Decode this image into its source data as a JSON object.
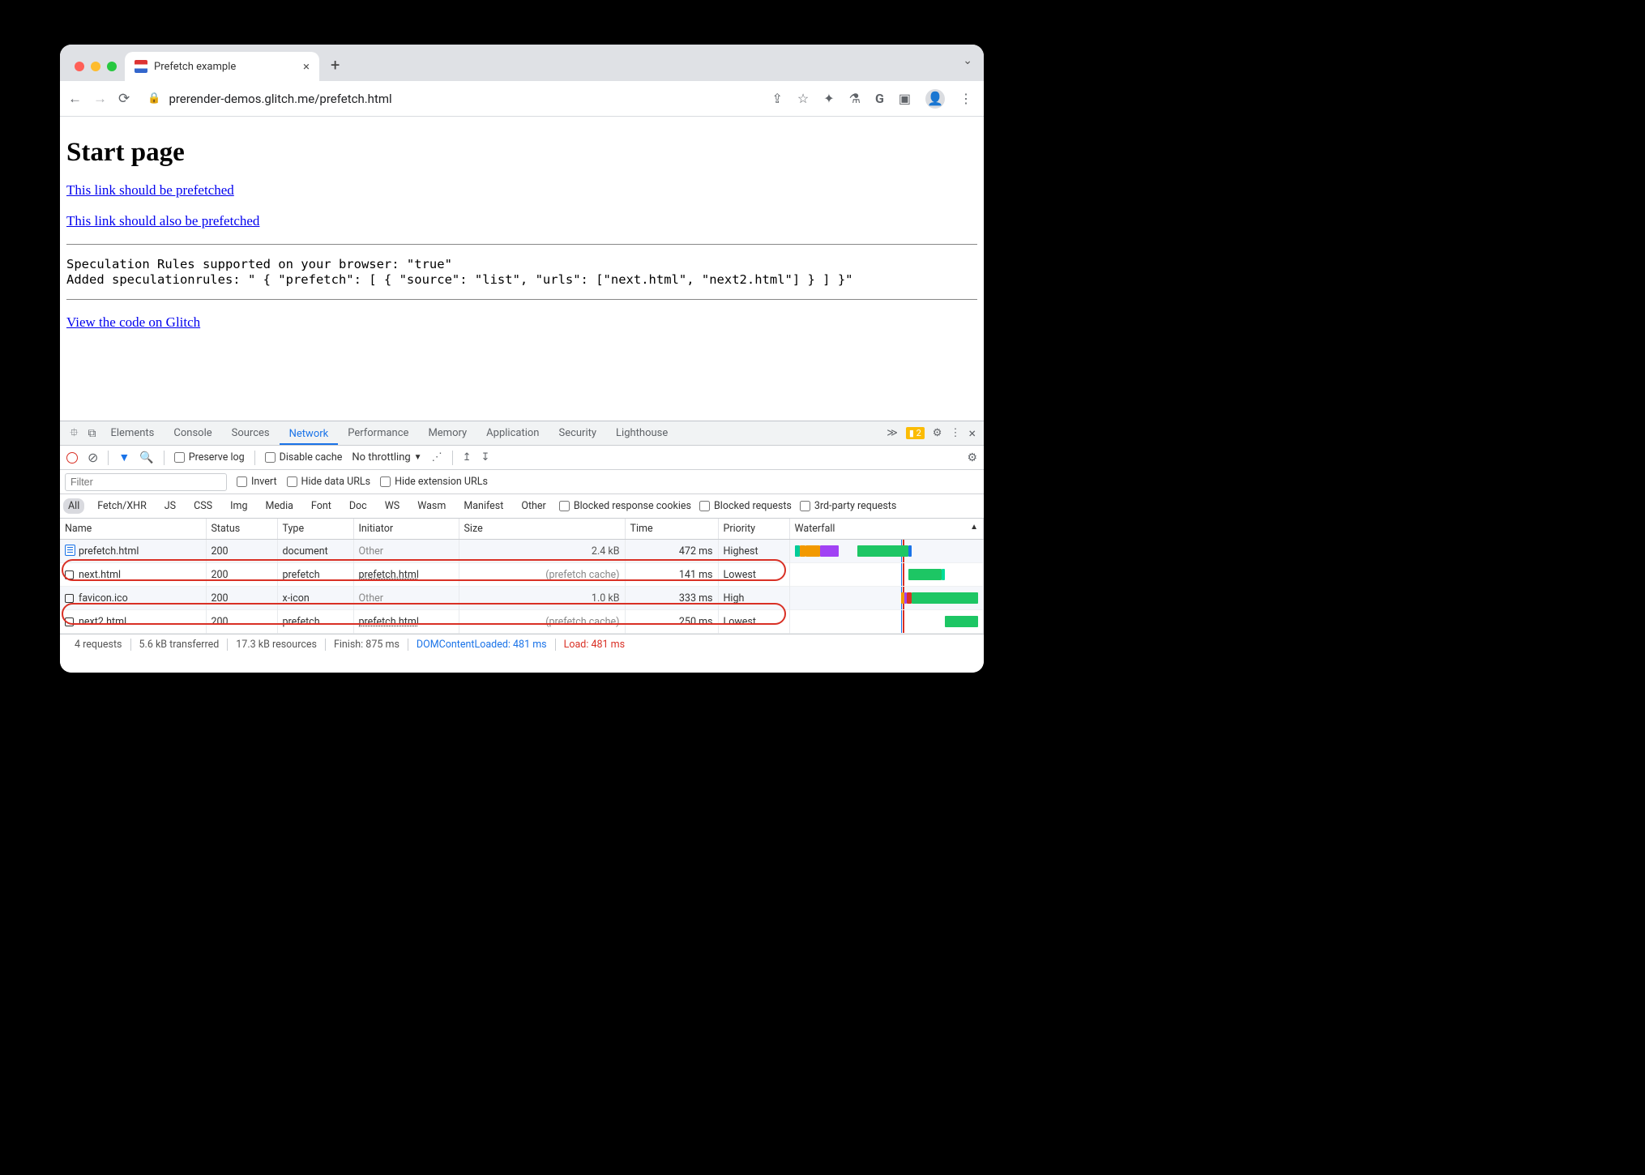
{
  "tab": {
    "title": "Prefetch example"
  },
  "url": "prerender-demos.glitch.me/prefetch.html",
  "page": {
    "heading": "Start page",
    "link1": "This link should be prefetched",
    "link2": "This link should also be prefetched",
    "code1": "Speculation Rules supported on your browser: \"true\"",
    "code2": "Added speculationrules: \" { \"prefetch\": [ { \"source\": \"list\", \"urls\": [\"next.html\", \"next2.html\"] } ] }\"",
    "link3": "View the code on Glitch"
  },
  "devtools": {
    "tabs": [
      "Elements",
      "Console",
      "Sources",
      "Network",
      "Performance",
      "Memory",
      "Application",
      "Security",
      "Lighthouse"
    ],
    "warnCount": "2",
    "controls": {
      "preserve": "Preserve log",
      "disable": "Disable cache",
      "throttle": "No throttling"
    },
    "filterPlaceholder": "Filter",
    "filterOpts": {
      "invert": "Invert",
      "hideData": "Hide data URLs",
      "hideExt": "Hide extension URLs"
    },
    "types": [
      "All",
      "Fetch/XHR",
      "JS",
      "CSS",
      "Img",
      "Media",
      "Font",
      "Doc",
      "WS",
      "Wasm",
      "Manifest",
      "Other"
    ],
    "typeOpts": {
      "blockedCookies": "Blocked response cookies",
      "blockedReq": "Blocked requests",
      "thirdParty": "3rd-party requests"
    },
    "columns": [
      "Name",
      "Status",
      "Type",
      "Initiator",
      "Size",
      "Time",
      "Priority",
      "Waterfall"
    ],
    "rows": [
      {
        "name": "prefetch.html",
        "status": "200",
        "type": "document",
        "initiator": "Other",
        "size": "2.4 kB",
        "time": "472 ms",
        "priority": "Highest",
        "icon": "doc",
        "initiatorLink": false,
        "cache": false
      },
      {
        "name": "next.html",
        "status": "200",
        "type": "prefetch",
        "initiator": "prefetch.html",
        "size": "(prefetch cache)",
        "time": "141 ms",
        "priority": "Lowest",
        "icon": "out",
        "initiatorLink": true,
        "cache": true
      },
      {
        "name": "favicon.ico",
        "status": "200",
        "type": "x-icon",
        "initiator": "Other",
        "size": "1.0 kB",
        "time": "333 ms",
        "priority": "High",
        "icon": "out",
        "initiatorLink": false,
        "cache": false
      },
      {
        "name": "next2.html",
        "status": "200",
        "type": "prefetch",
        "initiator": "prefetch.html",
        "size": "(prefetch cache)",
        "time": "250 ms",
        "priority": "Lowest",
        "icon": "out",
        "initiatorLink": true,
        "cache": true
      }
    ],
    "status": {
      "requests": "4 requests",
      "transferred": "5.6 kB transferred",
      "resources": "17.3 kB resources",
      "finish": "Finish: 875 ms",
      "dcl": "DOMContentLoaded: 481 ms",
      "load": "Load: 481 ms"
    }
  }
}
